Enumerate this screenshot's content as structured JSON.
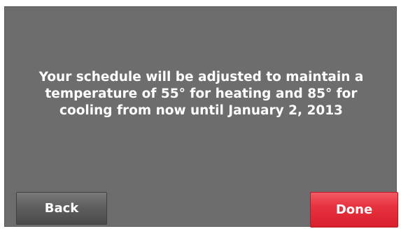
{
  "message": "Your schedule will be adjusted to maintain a\ntemperature of 55° for heating and 85° for\ncooling from now until January 2, 2013",
  "buttons": {
    "back_label": "Back",
    "done_label": "Done"
  },
  "colors": {
    "screen_background": "#6d6d6d",
    "back_button": "#5f5f5f",
    "done_button": "#e8323f",
    "text": "#ffffff"
  }
}
